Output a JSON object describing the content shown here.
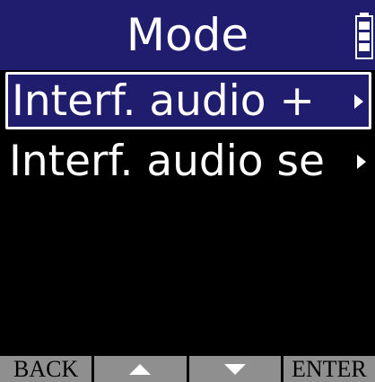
{
  "header": {
    "title": "Mode",
    "battery_icon": "battery-icon"
  },
  "menu": {
    "items": [
      {
        "label": "Interf. audio + ",
        "selected": true,
        "icon": "chevron-right-icon"
      },
      {
        "label": "Interf. audio se",
        "selected": false,
        "icon": "chevron-right-icon"
      }
    ]
  },
  "softkeys": {
    "back": "BACK",
    "up_icon": "up-arrow-icon",
    "down_icon": "down-arrow-icon",
    "enter": "ENTER"
  },
  "colors": {
    "title_bar": "#201c6e",
    "selection": "#201c6e",
    "softkey_bg": "#8f8f8f",
    "background": "#000000"
  }
}
